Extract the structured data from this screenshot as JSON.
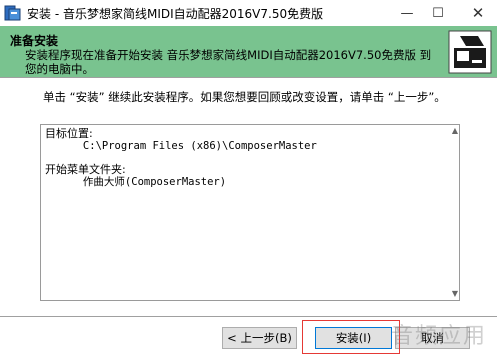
{
  "window": {
    "title": "安装 - 音乐梦想家简线MIDI自动配器2016V7.50免费版",
    "minimize": "—",
    "maximize": "☐",
    "close": "✕"
  },
  "header": {
    "title": "准备安装",
    "description": "安装程序现在准备开始安装 音乐梦想家简线MIDI自动配器2016V7.50免费版 到您的电脑中。"
  },
  "intro": "单击 “安装” 继续此安装程序。如果您想要回顾或改变设置，请单击 “上一步”。",
  "details": {
    "target_label": "目标位置:",
    "target_path": "      C:\\Program Files (x86)\\ComposerMaster",
    "menu_label": "开始菜单文件夹:",
    "menu_folder": "      作曲大师(ComposerMaster)"
  },
  "buttons": {
    "back": "< 上一步(B)",
    "install": "安装(I)",
    "cancel": "取消"
  },
  "watermark": "音频应用"
}
